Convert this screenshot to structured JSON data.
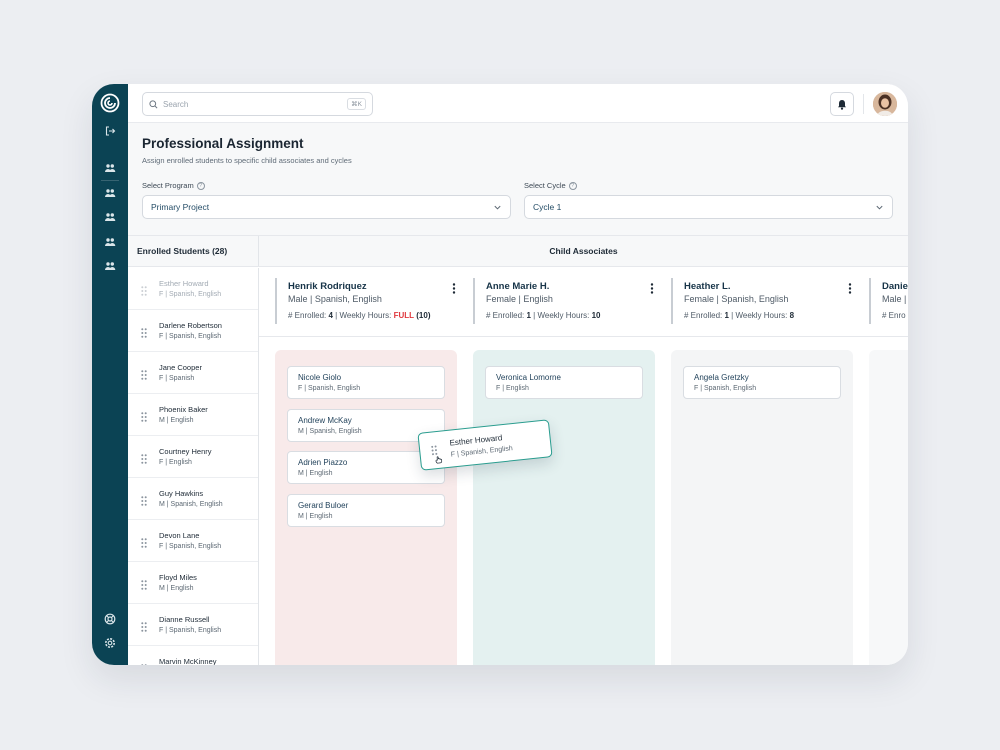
{
  "search": {
    "placeholder": "Search",
    "shortcut": "⌘K"
  },
  "header": {
    "title": "Professional Assignment",
    "subtitle": "Assign enrolled students to specific child associates and cycles"
  },
  "program": {
    "label": "Select Program",
    "value": "Primary Project"
  },
  "cycle": {
    "label": "Select Cycle",
    "value": "Cycle 1"
  },
  "students_panel": {
    "title": "Enrolled Students (28)",
    "items": [
      {
        "name": "Esther Howard",
        "meta": "F  |  Spanish, English"
      },
      {
        "name": "Darlene Robertson",
        "meta": "F  |  Spanish, English"
      },
      {
        "name": "Jane Cooper",
        "meta": "F  |  Spanish"
      },
      {
        "name": "Phoenix Baker",
        "meta": "M  |  English"
      },
      {
        "name": "Courtney Henry",
        "meta": "F  |  English"
      },
      {
        "name": "Guy Hawkins",
        "meta": "M  |  Spanish, English"
      },
      {
        "name": "Devon Lane",
        "meta": "F  |  Spanish, English"
      },
      {
        "name": "Floyd Miles",
        "meta": "M  |  English"
      },
      {
        "name": "Dianne Russell",
        "meta": "F  |  Spanish, English"
      },
      {
        "name": "Marvin McKinney",
        "meta": ""
      }
    ]
  },
  "associates_panel": {
    "title": "Child Associates",
    "associates": [
      {
        "name": "Henrik Rodriquez",
        "meta": "Male  |  Spanish, English",
        "enrolled_label": "# Enrolled:",
        "enrolled": "4",
        "hours_label": "Weekly Hours:",
        "hours": "",
        "full_label": "FULL",
        "hours_paren": "(10)",
        "lane_color": "#f8eaea",
        "students": [
          {
            "name": "Nicole Giolo",
            "meta": "F  |  Spanish, English"
          },
          {
            "name": "Andrew McKay",
            "meta": "M  |  Spanish, English"
          },
          {
            "name": "Adrien Piazzo",
            "meta": "M  |  English"
          },
          {
            "name": "Gerard Buloer",
            "meta": "M  |  English"
          }
        ]
      },
      {
        "name": "Anne Marie H.",
        "meta": "Female  |  English",
        "enrolled_label": "# Enrolled:",
        "enrolled": "1",
        "hours_label": "Weekly Hours:",
        "hours": "10",
        "full_label": "",
        "hours_paren": "",
        "lane_color": "#e4f1f0",
        "students": [
          {
            "name": "Veronica Lomorne",
            "meta": "F  |  English"
          }
        ]
      },
      {
        "name": "Heather L.",
        "meta": "Female  |  Spanish, English",
        "enrolled_label": "# Enrolled:",
        "enrolled": "1",
        "hours_label": "Weekly Hours:",
        "hours": "8",
        "full_label": "",
        "hours_paren": "",
        "lane_color": "#f4f5f6",
        "students": [
          {
            "name": "Angela Gretzky",
            "meta": "F  |  Spanish, English"
          }
        ]
      },
      {
        "name": "Danie",
        "meta": "Male  |",
        "enrolled_label": "# Enro",
        "enrolled": "",
        "hours_label": "",
        "hours": "",
        "full_label": "",
        "hours_paren": "",
        "lane_color": "#f7f8f9",
        "students": []
      }
    ]
  },
  "dragging": {
    "name": "Esther Howard",
    "meta": "F  |  Spanish, English"
  },
  "colors": {
    "rail": "#0b4354",
    "accent": "#2a9d8f",
    "full": "#e0383e"
  },
  "icons": [
    "logo-icon",
    "logout-icon",
    "users-icon",
    "search-icon",
    "bell-icon",
    "help-icon",
    "settings-icon",
    "drag-handle-icon",
    "kebab-icon",
    "chevron-down-icon",
    "grab-hand-icon"
  ]
}
